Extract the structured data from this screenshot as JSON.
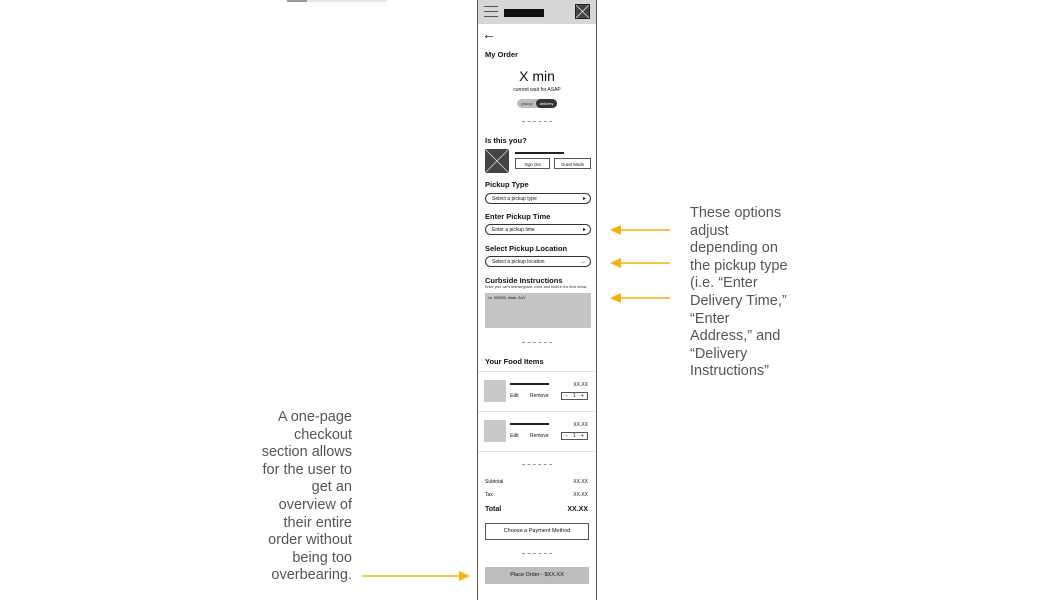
{
  "accent_color": "#f0b310",
  "header": {
    "menu_icon": "hamburger-icon",
    "close_icon": "close-icon"
  },
  "order": {
    "back_icon": "arrow-left-icon",
    "title": "My Order",
    "wait_time": "X min",
    "wait_caption": "current wait for ASAP",
    "toggle": {
      "options": [
        "pickup",
        "delivery"
      ],
      "selected": "delivery"
    }
  },
  "user": {
    "title": "Is this you?",
    "sign_out_label": "Sign Out",
    "guest_mode_label": "Guest Mode"
  },
  "pickup_type": {
    "label": "Pickup Type",
    "placeholder": "Select a pickup type"
  },
  "pickup_time": {
    "label": "Enter Pickup Time",
    "placeholder": "Enter a pickup time"
  },
  "pickup_location": {
    "label": "Select Pickup Location",
    "placeholder": "Select a pickup location"
  },
  "curbside": {
    "label": "Curbside Instructions",
    "hint": "Enter your car's license/grade, color, and build in the field below.",
    "value": "i.e. 000000, black, SUV"
  },
  "food": {
    "title": "Your Food Items",
    "items": [
      {
        "price": "XX.XX",
        "edit": "Edit",
        "remove": "Remove",
        "qty": "1"
      },
      {
        "price": "XX.XX",
        "edit": "Edit",
        "remove": "Remove",
        "qty": "1"
      }
    ]
  },
  "summary": {
    "subtotal_label": "Subtotal",
    "subtotal_value": "XX.XX",
    "tax_label": "Tax",
    "tax_value": "XX.XX",
    "total_label": "Total",
    "total_value": "XX.XX"
  },
  "payment_button": "Choose a Payment Method",
  "place_order_button": "Place Order - $XX.XX",
  "annotations": {
    "right": [
      "These options",
      "adjust",
      "depending on",
      "the pickup type",
      "(i.e. “Enter",
      "Delivery Time,”",
      "“Enter",
      "Address,” and",
      "“Delivery",
      "Instructions”"
    ],
    "left": [
      "A one-page",
      "checkout",
      "section allows",
      "for the user to",
      "get an",
      "overview of",
      "their entire",
      "order without",
      "being too",
      "overbearing."
    ]
  }
}
